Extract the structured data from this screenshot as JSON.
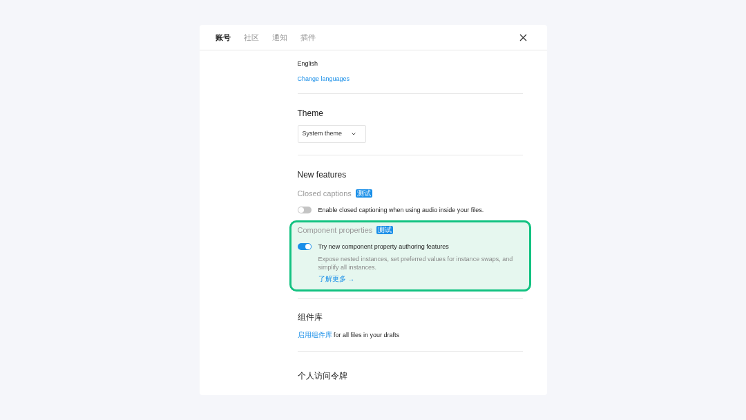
{
  "tabs": [
    {
      "label": "账号",
      "selected": true
    },
    {
      "label": "社区",
      "selected": false
    },
    {
      "label": "通知",
      "selected": false
    },
    {
      "label": "插件",
      "selected": false
    }
  ],
  "language": {
    "value": "English",
    "link": "Change languages"
  },
  "theme": {
    "title": "Theme",
    "dropdown": "System theme"
  },
  "new_features": {
    "title": "New features",
    "features": [
      {
        "name": "Closed captions",
        "badge": "测试",
        "highlighted": false,
        "toggle_on": false,
        "toggle_label": "Enable closed captioning when using audio inside your files."
      },
      {
        "name": "Component properties",
        "badge": "测试",
        "highlighted": true,
        "toggle_on": true,
        "toggle_label": "Try new component property authoring features",
        "description": "Expose nested instances, set preferred values for instance swaps, and simplify all instances.",
        "link": "了解更多 →"
      }
    ]
  },
  "library": {
    "title": "组件库",
    "link": "启用组件库",
    "text": "for all files in your drafts"
  },
  "tokens": {
    "title": "个人访问令牌"
  }
}
